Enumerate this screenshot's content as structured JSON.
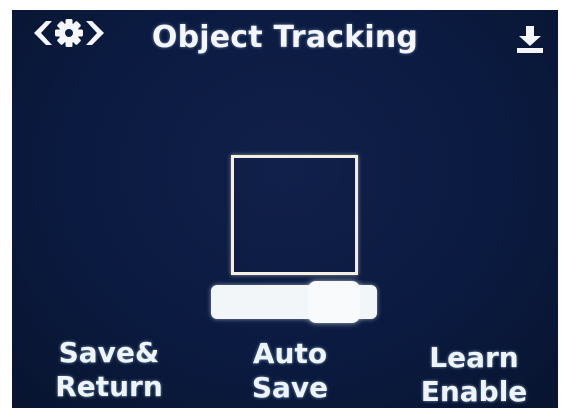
{
  "header": {
    "title": "Object Tracking",
    "left_nav_icon": "settings-nav-arrows-icon",
    "right_icon": "download-icon"
  },
  "tracking": {
    "slider_position": 0.85
  },
  "bottom_buttons": [
    {
      "line1": "Save&",
      "line2": "Return"
    },
    {
      "line1": "Auto",
      "line2": "Save"
    },
    {
      "line1": "Learn",
      "line2": "Enable"
    }
  ],
  "colors": {
    "background": "#0b1a40",
    "text": "#eef4fa",
    "box_outline": "#f3efe3"
  }
}
